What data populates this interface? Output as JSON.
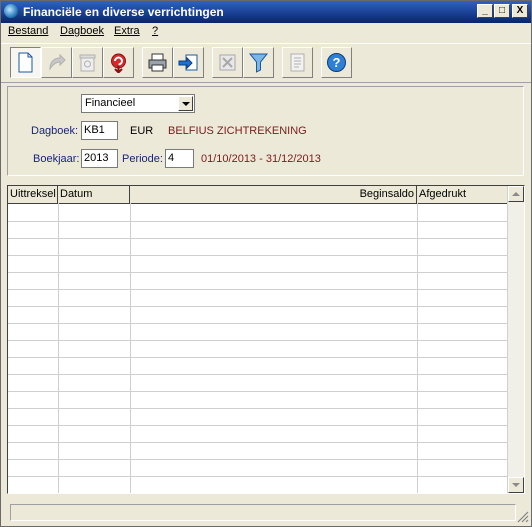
{
  "window": {
    "title": "Financiële en diverse verrichtingen"
  },
  "title_buttons": {
    "minimize": "_",
    "maximize": "□",
    "close": "X"
  },
  "menu": [
    {
      "label": "Bestand"
    },
    {
      "label": "Dagboek"
    },
    {
      "label": "Extra"
    },
    {
      "label": "?"
    }
  ],
  "toolbar": {
    "buttons": [
      {
        "icon": "new-document-icon"
      },
      {
        "icon": "redo-arrow-icon"
      },
      {
        "icon": "recycle-icon"
      },
      {
        "icon": "undo-red-icon"
      },
      {
        "icon": "printer-icon"
      },
      {
        "icon": "export-icon"
      },
      {
        "icon": "excel-icon"
      },
      {
        "icon": "filter-icon"
      },
      {
        "icon": "document-list-icon"
      },
      {
        "icon": "help-icon"
      }
    ]
  },
  "filters": {
    "type_select": "Financieel",
    "dagboek_label": "Dagboek:",
    "dagboek_value": "KB1",
    "currency": "EUR",
    "bank_name": "BELFIUS ZICHTREKENING",
    "boekjaar_label": "Boekjaar:",
    "boekjaar_value": "2013",
    "periode_label": "Periode:",
    "periode_value": "4",
    "period_range": "01/10/2013 - 31/12/2013"
  },
  "grid": {
    "columns": [
      "Uittreksel",
      "Datum",
      "",
      "Beginsaldo",
      "Afgedrukt"
    ],
    "rows": []
  },
  "colors": {
    "title_bar": "#0a246a",
    "label": "#1a237e",
    "bank_name": "#7b1b1b"
  }
}
